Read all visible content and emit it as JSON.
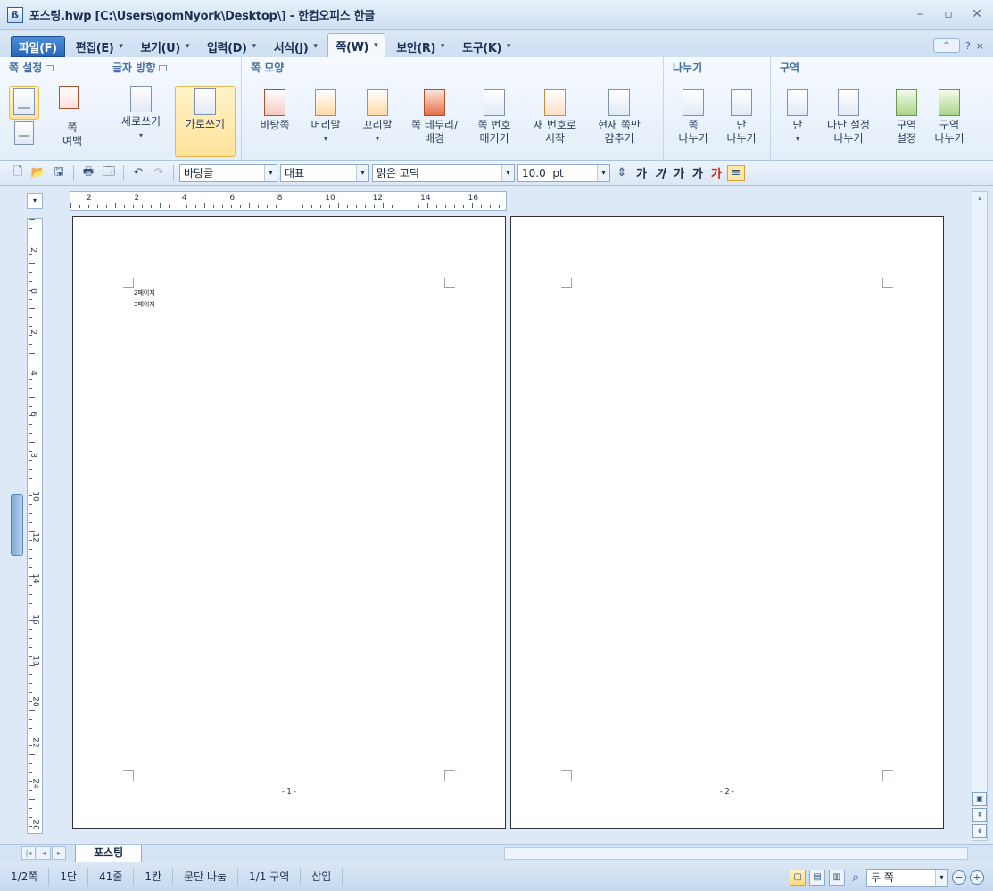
{
  "window": {
    "title": "포스팅.hwp [C:\\Users\\gomNyork\\Desktop\\] - 한컴오피스 한글",
    "app_icon": "hwp-app-icon",
    "controls": [
      "minimize-icon",
      "maximize-icon",
      "close-icon"
    ]
  },
  "menu": {
    "tabs": [
      {
        "label": "파일(F)",
        "arrow": ""
      },
      {
        "label": "편집(E)",
        "arrow": "▾"
      },
      {
        "label": "보기(U)",
        "arrow": "▾"
      },
      {
        "label": "입력(D)",
        "arrow": "▾"
      },
      {
        "label": "서식(J)",
        "arrow": "▾"
      },
      {
        "label": "쪽(W)",
        "arrow": "▾"
      },
      {
        "label": "보안(R)",
        "arrow": "▾"
      },
      {
        "label": "도구(K)",
        "arrow": "▾"
      }
    ],
    "active_tab": "쪽(W)",
    "help": "?",
    "close": "×",
    "collapse": "^"
  },
  "ribbon": {
    "groups": {
      "page_setup": "쪽 설정",
      "text_direction": "글자 방향",
      "page_shape": "쪽 모양",
      "breaks": "나누기",
      "section": "구역"
    },
    "buttons": {
      "page_margin_1": "쪽",
      "page_margin_2": "여백",
      "vertical_writing": "세로쓰기",
      "horizontal_writing": "가로쓰기",
      "master_page": "바탕쪽",
      "header": "머리말",
      "footer": "꼬리말",
      "border_bg_1": "쪽 테두리/",
      "border_bg_2": "배경",
      "page_number_1": "쪽 번호",
      "page_number_2": "매기기",
      "new_number_1": "새 번호로",
      "new_number_2": "시작",
      "hide_page_1": "현재 쪽만",
      "hide_page_2": "감추기",
      "page_break_1": "쪽",
      "page_break_2": "나누기",
      "column_break_1": "단",
      "column_break_2": "나누기",
      "columns": "단",
      "multi_column_1": "다단 설정",
      "multi_column_2": "나누기",
      "section_setup_1": "구역",
      "section_setup_2": "설정",
      "section_break_1": "구역",
      "section_break_2": "나누기"
    }
  },
  "toolbar": {
    "style": "바탕글",
    "language": "대표",
    "font": "맑은 고딕",
    "size": "10.0",
    "unit": "pt",
    "format_bold": "가",
    "format_italic": "가",
    "format_underline": "가",
    "format_strike": "가",
    "format_color": "가"
  },
  "ruler": {
    "h_labels": [
      "2",
      "2",
      "4",
      "6",
      "8",
      "10",
      "12",
      "14",
      "16"
    ],
    "v_labels": [
      "2",
      "0",
      "2",
      "4",
      "6",
      "8",
      "10",
      "12",
      "14",
      "16",
      "18",
      "20",
      "22",
      "24",
      "26"
    ]
  },
  "document": {
    "pages": [
      {
        "lines": [
          "2페이지",
          "3페이지"
        ],
        "number": "- 1 -"
      },
      {
        "lines": [],
        "number": "- 2 -"
      }
    ]
  },
  "tabs": {
    "document_tab": "포스팅"
  },
  "status": {
    "page": "1/2쪽",
    "column": "1단",
    "line": "41줄",
    "col_pos": "1칸",
    "paragraph": "문단 나눔",
    "section": "1/1 구역",
    "mode": "삽입",
    "zoom": "두 쪽"
  }
}
